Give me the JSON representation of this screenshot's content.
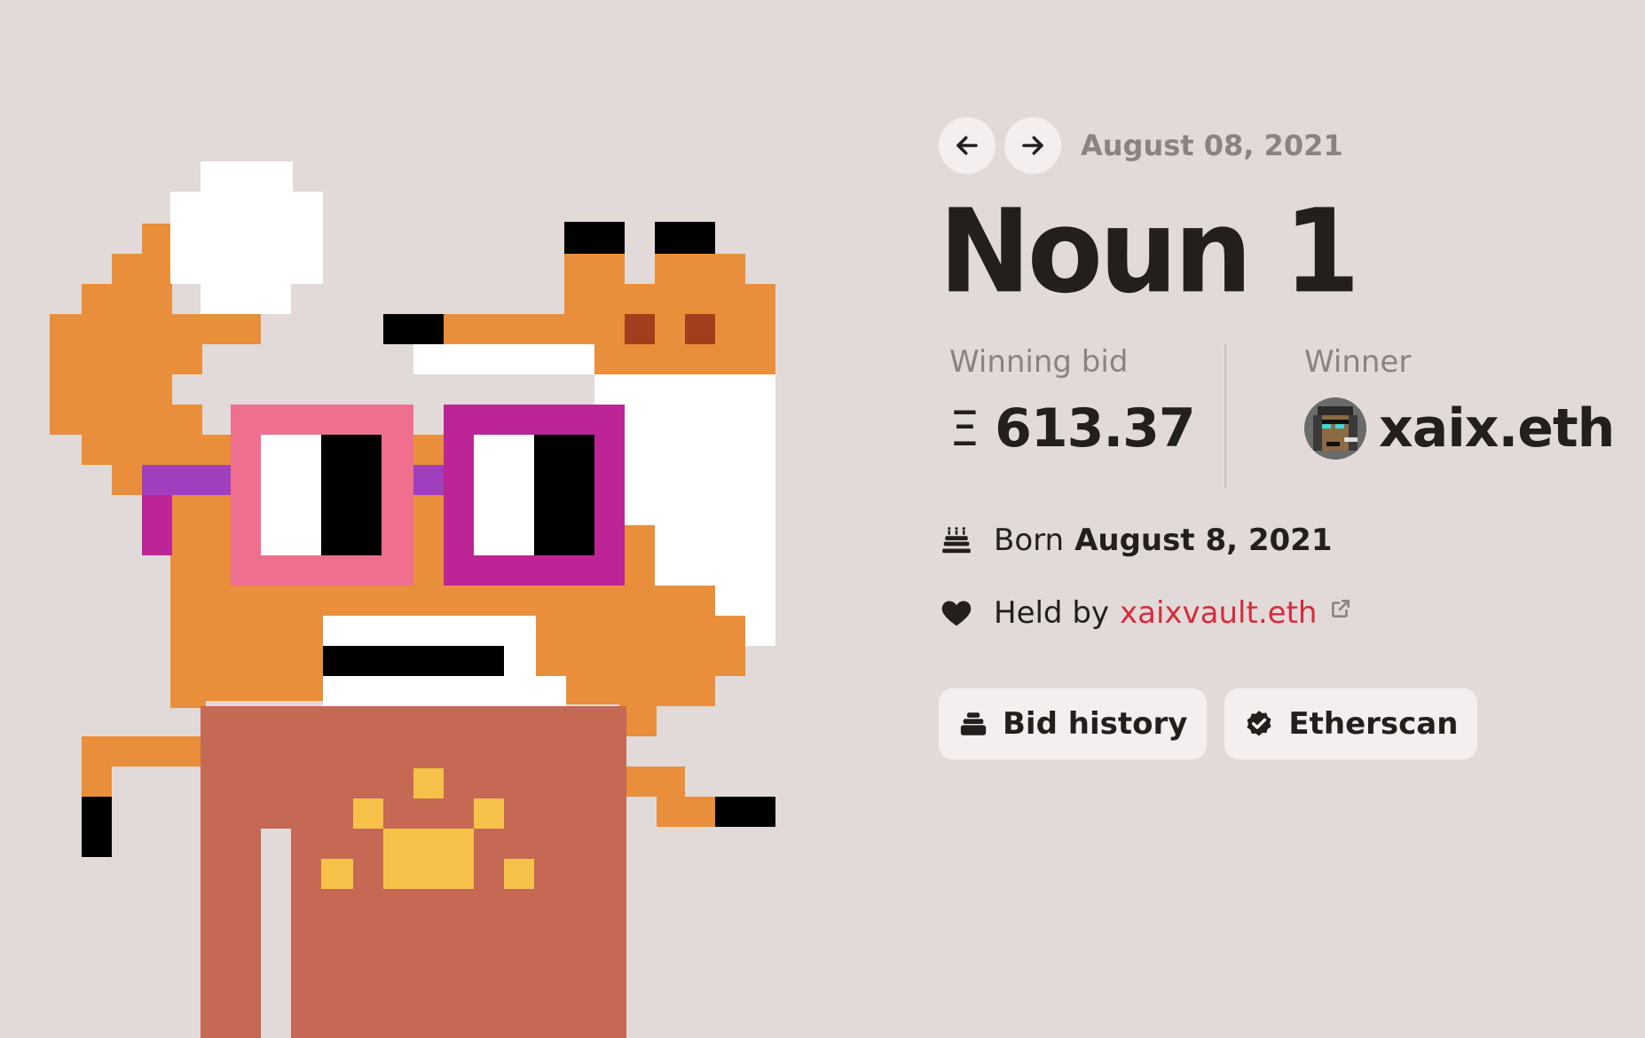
{
  "nav": {
    "prev_icon": "arrow-left-icon",
    "next_icon": "arrow-right-icon",
    "date": "August 08, 2021"
  },
  "title": "Noun 1",
  "bid": {
    "label": "Winning bid",
    "symbol": "Ξ",
    "amount": "613.37"
  },
  "winner": {
    "label": "Winner",
    "name": "xaix.eth",
    "avatar_icon": "punk-avatar-icon"
  },
  "born": {
    "icon": "cake-icon",
    "prefix": "Born",
    "date": "August 8, 2021"
  },
  "held": {
    "icon": "heart-icon",
    "prefix": "Held by",
    "owner": "xaixvault.eth",
    "link_icon": "external-link-icon"
  },
  "buttons": {
    "bid_history": "Bid history",
    "bid_history_icon": "stack-icon",
    "etherscan": "Etherscan",
    "etherscan_icon": "verified-badge-icon"
  },
  "colors": {
    "background": "#e1dad8",
    "orange": "#e98f3b",
    "pink_glasses": "#ee6f8e",
    "magenta_glasses": "#bd2596",
    "body": "#c56955",
    "link": "#d62c3c"
  }
}
